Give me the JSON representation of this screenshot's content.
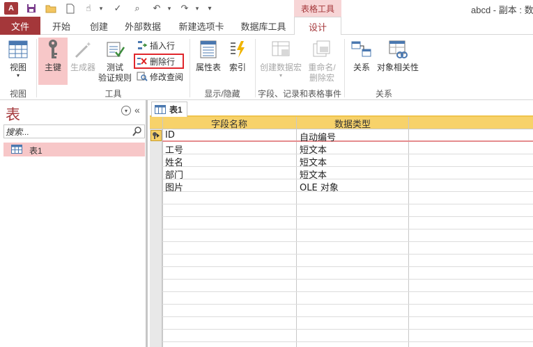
{
  "app": {
    "logo_text": "A",
    "context_tab_label": "表格工具",
    "doc_title": "abcd - 副本 : 数"
  },
  "tabs": [
    "文件",
    "开始",
    "创建",
    "外部数据",
    "新建选项卡",
    "数据库工具",
    "设计"
  ],
  "ribbon": {
    "view": {
      "label": "视图",
      "group": "视图"
    },
    "tools": {
      "primary_key": "主键",
      "builder": "生成器",
      "test_rules": [
        "测试",
        "验证规则"
      ],
      "insert_row": "插入行",
      "delete_row": "删除行",
      "modify_lookup": "修改查阅",
      "group": "工具"
    },
    "show_hide": {
      "property_sheet": "属性表",
      "indexes": "索引",
      "group": "显示/隐藏"
    },
    "field_events": {
      "create_macro": "创建数据宏",
      "rename_delete_macro": [
        "重命名/",
        "删除宏"
      ],
      "group": "字段、记录和表格事件"
    },
    "relationships": {
      "relationships": "关系",
      "object_dependencies": "对象相关性",
      "group": "关系"
    }
  },
  "nav": {
    "title": "表",
    "search_placeholder": "搜索...",
    "items": [
      "表1"
    ]
  },
  "document": {
    "tab_label": "表1",
    "columns": [
      "字段名称",
      "数据类型"
    ],
    "rows": [
      {
        "field": "ID",
        "type": "自动编号",
        "primary": true
      },
      {
        "field": "工号",
        "type": "短文本"
      },
      {
        "field": "姓名",
        "type": "短文本"
      },
      {
        "field": "部门",
        "type": "短文本"
      },
      {
        "field": "图片",
        "type": "OLE 对象"
      }
    ]
  },
  "colors": {
    "accent": "#a4373a",
    "highlight": "#f7c7c8",
    "header": "#f7d26a",
    "selected_box": "#e0262b"
  }
}
